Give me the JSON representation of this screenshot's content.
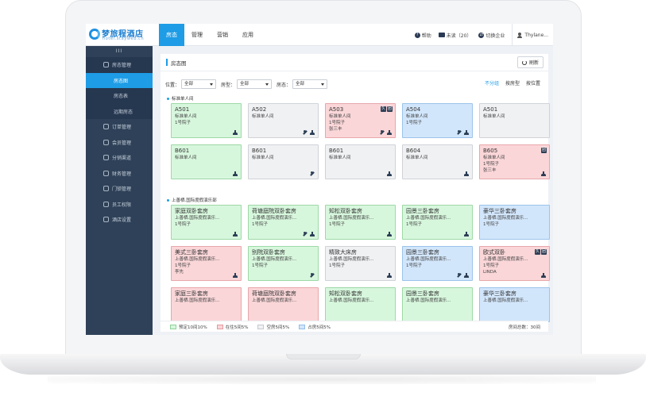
{
  "brand": {
    "name": "梦旅程酒店",
    "domain": "hotel.stayweb.cn"
  },
  "nav": {
    "tabs": [
      "房态",
      "管理",
      "营销",
      "应用"
    ],
    "active": 0
  },
  "top_right": {
    "help": "帮助",
    "unread": "未读（20）",
    "switch_company": "切换企业",
    "user": "Thylane..."
  },
  "sidebar": {
    "toggle": "III",
    "items": [
      {
        "label": "房态管理",
        "kind": "group"
      },
      {
        "label": "房态图",
        "kind": "sub-active"
      },
      {
        "label": "房态表",
        "kind": "sub"
      },
      {
        "label": "远期房态",
        "kind": "sub"
      },
      {
        "label": "订单管理",
        "kind": "item"
      },
      {
        "label": "会员管理",
        "kind": "item"
      },
      {
        "label": "分销渠道",
        "kind": "item"
      },
      {
        "label": "财务管理",
        "kind": "item"
      },
      {
        "label": "门锁管理",
        "kind": "item"
      },
      {
        "label": "员工权限",
        "kind": "item"
      },
      {
        "label": "酒店设置",
        "kind": "item"
      }
    ]
  },
  "page": {
    "title": "房态图",
    "refresh": "刷新"
  },
  "filters": {
    "location_label": "位置：",
    "location_value": "全部",
    "roomtype_label": "房型：",
    "roomtype_value": "全部",
    "status_label": "房态：",
    "status_value": "全部"
  },
  "views": [
    "不分组",
    "按房型",
    "按位置"
  ],
  "sections": [
    "标准单人间",
    "上善栖.国际度假演乐部"
  ],
  "rooms_group1": [
    {
      "no": "A501",
      "type": "标准单人间",
      "bld": "1号院子",
      "guest": "",
      "status": "booked",
      "tags": [],
      "ind": [
        "clean"
      ]
    },
    {
      "no": "A502",
      "type": "标准单人间",
      "bld": "",
      "guest": "",
      "status": "empty",
      "tags": [],
      "ind": [
        "tool",
        "clean"
      ]
    },
    {
      "no": "A503",
      "type": "标准单人间",
      "bld": "1号院子",
      "guest": "张三丰",
      "status": "stay",
      "tags": [
        "久",
        "团"
      ],
      "ind": [
        "tool",
        "clean"
      ]
    },
    {
      "no": "A504",
      "type": "标准单人间",
      "bld": "1号院子",
      "guest": "",
      "status": "occupied",
      "tags": [],
      "ind": [
        "tool",
        "clean"
      ]
    },
    {
      "no": "A501",
      "type": "标准单人间",
      "bld": "",
      "guest": "",
      "status": "empty",
      "tags": [],
      "ind": []
    },
    {
      "no": "B601",
      "type": "标准单人间",
      "bld": "",
      "guest": "",
      "status": "booked",
      "tags": [],
      "ind": [
        "clean"
      ]
    },
    {
      "no": "B601",
      "type": "标准单人间",
      "bld": "",
      "guest": "",
      "status": "empty",
      "tags": [],
      "ind": [
        "tool"
      ]
    },
    {
      "no": "B601",
      "type": "标准单人间",
      "bld": "",
      "guest": "",
      "status": "empty",
      "tags": [],
      "ind": [
        "clean"
      ]
    },
    {
      "no": "B604",
      "type": "标准单人间",
      "bld": "",
      "guest": "",
      "status": "empty",
      "tags": [],
      "ind": [
        "clean"
      ]
    },
    {
      "no": "B605",
      "type": "标准单人间",
      "bld": "1号院子",
      "guest": "张三丰",
      "status": "stay",
      "tags": [
        "团"
      ],
      "ind": [
        "clean"
      ]
    }
  ],
  "rooms_group2": [
    {
      "no": "家庭双卧套房",
      "type": "上善栖.国际度假演乐...",
      "bld": "1号院子",
      "guest": "",
      "status": "booked",
      "tags": [],
      "ind": [
        "clean"
      ]
    },
    {
      "no": "荷塘庭院双卧套房",
      "type": "上善栖.国际度假演乐...",
      "bld": "1号院子",
      "guest": "",
      "status": "booked",
      "tags": [],
      "ind": [
        "tool",
        "clean"
      ]
    },
    {
      "no": "知松双卧套房",
      "type": "上善栖.国际度假演乐...",
      "bld": "1号院子",
      "guest": "",
      "status": "booked",
      "tags": [],
      "ind": [
        "clean"
      ]
    },
    {
      "no": "园景三卧套房",
      "type": "上善栖.国际度假演乐...",
      "bld": "1号院子",
      "guest": "",
      "status": "booked",
      "tags": [],
      "ind": [
        "clean"
      ]
    },
    {
      "no": "豪华三卧套房",
      "type": "上善栖.国际度假演乐...",
      "bld": "1号院子",
      "guest": "",
      "status": "occupied",
      "tags": [],
      "ind": []
    },
    {
      "no": "美式三卧套房",
      "type": "上善栖.国际度假演乐...",
      "bld": "1号院子",
      "guest": "李先",
      "status": "stay",
      "tags": [],
      "ind": [
        "clean"
      ]
    },
    {
      "no": "别院双卧套房",
      "type": "上善栖.国际度假演乐...",
      "bld": "1号院子",
      "guest": "",
      "status": "booked",
      "tags": [],
      "ind": [
        "tool"
      ]
    },
    {
      "no": "精致大床房",
      "type": "上善栖.国际度假演乐...",
      "bld": "1号院子",
      "guest": "",
      "status": "empty",
      "tags": [],
      "ind": [
        "clean"
      ]
    },
    {
      "no": "园景三卧套房",
      "type": "上善栖.国际度假演乐...",
      "bld": "1号院子",
      "guest": "",
      "status": "occupied",
      "tags": [],
      "ind": [
        "tool",
        "clean"
      ]
    },
    {
      "no": "欧式双卧",
      "type": "上善栖.国际度假演乐...",
      "bld": "1号院子",
      "guest": "LINDA",
      "status": "stay",
      "tags": [
        "久",
        "团"
      ],
      "ind": [
        "clean"
      ]
    },
    {
      "no": "家庭三卧套房",
      "type": "上善栖.国际度假演乐...",
      "bld": "",
      "guest": "",
      "status": "stay",
      "tags": [],
      "ind": []
    },
    {
      "no": "荷塘庭院双卧套房",
      "type": "上善栖.国际度假演乐...",
      "bld": "",
      "guest": "",
      "status": "stay",
      "tags": [],
      "ind": []
    },
    {
      "no": "知松双卧套房",
      "type": "上善栖.国际度假演乐...",
      "bld": "",
      "guest": "",
      "status": "booked",
      "tags": [],
      "ind": []
    },
    {
      "no": "园景三卧套房",
      "type": "上善栖.国际度假演乐...",
      "bld": "",
      "guest": "",
      "status": "booked",
      "tags": [],
      "ind": []
    },
    {
      "no": "豪华三卧套房",
      "type": "上善栖.国际度假演乐...",
      "bld": "",
      "guest": "",
      "status": "occupied",
      "tags": [],
      "ind": []
    }
  ],
  "legend": [
    {
      "label": "预定10间10%",
      "color": "#d7f7dd",
      "border": "#8fd19a"
    },
    {
      "label": "在住5间5%",
      "color": "#fad6d8",
      "border": "#e39aa0"
    },
    {
      "label": "空房5间5%",
      "color": "#f0f1f3",
      "border": "#c4c8ce"
    },
    {
      "label": "占房5间5%",
      "color": "#d2e6fb",
      "border": "#93bde8"
    }
  ],
  "total": "房间总数：30间",
  "colors": {
    "accent": "#1e9ce6",
    "sidebar": "#2e4158"
  }
}
